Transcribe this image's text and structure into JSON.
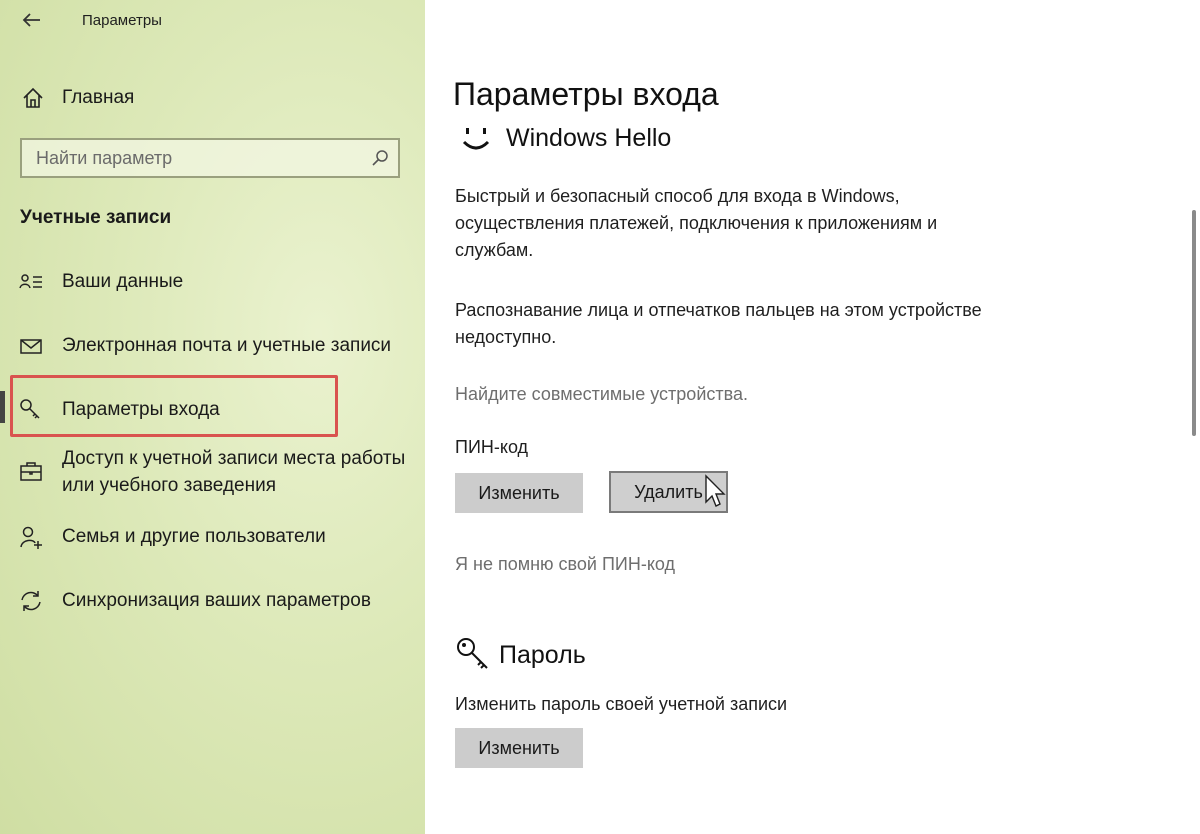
{
  "window": {
    "title": "Параметры"
  },
  "sidebar": {
    "home_label": "Главная",
    "search_placeholder": "Найти параметр",
    "section_title": "Учетные записи",
    "items": [
      {
        "label": "Ваши данные",
        "icon": "person-card-icon"
      },
      {
        "label": "Электронная почта и учетные записи",
        "icon": "mail-icon"
      },
      {
        "label": "Параметры входа",
        "icon": "key-icon",
        "selected": true
      },
      {
        "label_line1": "Доступ к учетной записи места работы",
        "label_line2": "или учебного заведения",
        "icon": "briefcase-icon"
      },
      {
        "label": "Семья и другие пользователи",
        "icon": "add-person-icon"
      },
      {
        "label": "Синхронизация ваших параметров",
        "icon": "sync-icon"
      }
    ]
  },
  "main": {
    "page_title": "Параметры входа",
    "hello": {
      "title": "Windows Hello",
      "desc_lines": [
        "Быстрый и безопасный способ для входа в Windows,",
        "осуществления платежей, подключения к приложениям и",
        "службам."
      ],
      "unavailable_lines": [
        "Распознавание лица и отпечатков пальцев на этом устройстве",
        "недоступно."
      ],
      "find_devices_link": "Найдите совместимые устройства."
    },
    "pin": {
      "title": "ПИН-код",
      "change_label": "Изменить",
      "remove_label": "Удалить",
      "forgot_link": "Я не помню свой ПИН-код"
    },
    "password": {
      "title": "Пароль",
      "desc": "Изменить пароль своей учетной записи",
      "change_label": "Изменить"
    }
  },
  "colors": {
    "sidebar_bg": "#dde9b9",
    "selection_outline": "#d9534f",
    "button_bg": "#cccccc",
    "muted_link": "#6e6e6e"
  }
}
